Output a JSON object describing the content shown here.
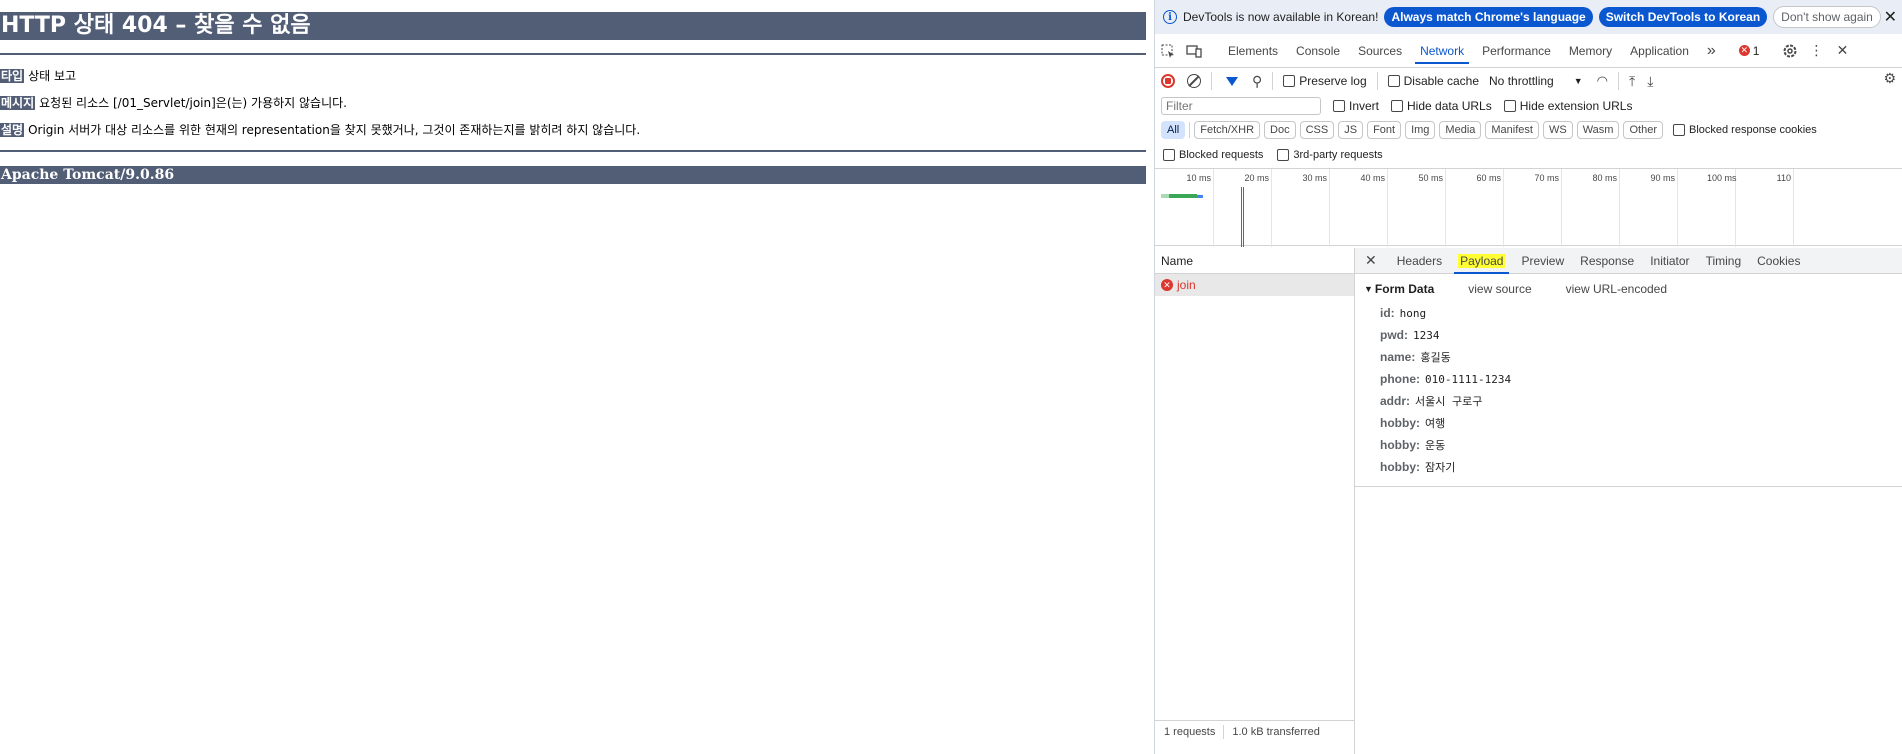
{
  "page": {
    "h1": "HTTP 상태 404 – 찾을 수 없음",
    "type_label": "타입",
    "type_value": "상태 보고",
    "message_label": "메시지",
    "message_value": "요청된 리소스 [/01_Servlet/join]은(는) 가용하지 않습니다.",
    "desc_label": "설명",
    "desc_value": "Origin 서버가 대상 리소스를 위한 현재의 representation을 찾지 못했거나, 그것이 존재하는지를 밝히려 하지 않습니다.",
    "footer": "Apache Tomcat/9.0.86"
  },
  "devtools": {
    "infobar": {
      "message": "DevTools is now available in Korean!",
      "btn_match": "Always match Chrome's language",
      "btn_switch": "Switch DevTools to Korean",
      "btn_dismiss": "Don't show again",
      "close": "✕"
    },
    "tabs": [
      "Elements",
      "Console",
      "Sources",
      "Network",
      "Performance",
      "Memory",
      "Application"
    ],
    "more_tabs": "»",
    "error_count": "1",
    "toolbar": {
      "preserve_log": "Preserve log",
      "disable_cache": "Disable cache",
      "throttling": "No throttling"
    },
    "filter": {
      "placeholder": "Filter",
      "invert": "Invert",
      "hide_data_urls": "Hide data URLs",
      "hide_extension_urls": "Hide extension URLs"
    },
    "type_filters": [
      "All",
      "Fetch/XHR",
      "Doc",
      "CSS",
      "JS",
      "Font",
      "Img",
      "Media",
      "Manifest",
      "WS",
      "Wasm",
      "Other"
    ],
    "blocked_response_cookies": "Blocked response cookies",
    "blocked_requests": "Blocked requests",
    "third_party_requests": "3rd-party requests",
    "timeline_labels": [
      "10 ms",
      "20 ms",
      "30 ms",
      "40 ms",
      "50 ms",
      "60 ms",
      "70 ms",
      "80 ms",
      "90 ms",
      "100 ms",
      "110"
    ],
    "list": {
      "header": "Name",
      "rows": [
        "join"
      ],
      "footer_requests": "1 requests",
      "footer_transferred": "1.0 kB transferred"
    },
    "detail_tabs": [
      "Headers",
      "Payload",
      "Preview",
      "Response",
      "Initiator",
      "Timing",
      "Cookies"
    ],
    "active_detail_tab": "Payload",
    "form_data": {
      "title": "Form Data",
      "view_source": "view source",
      "view_url_encoded": "view URL-encoded",
      "fields": [
        {
          "key": "id:",
          "value": "hong"
        },
        {
          "key": "pwd:",
          "value": "1234"
        },
        {
          "key": "name:",
          "value": "홍길동"
        },
        {
          "key": "phone:",
          "value": "010-1111-1234"
        },
        {
          "key": "addr:",
          "value": "서울시 구로구"
        },
        {
          "key": "hobby:",
          "value": "여행"
        },
        {
          "key": "hobby:",
          "value": "운동"
        },
        {
          "key": "hobby:",
          "value": "잠자기"
        }
      ]
    },
    "colors": {
      "accent": "#0b57d0",
      "error": "#dc362e",
      "tomcat": "#525d76"
    }
  }
}
